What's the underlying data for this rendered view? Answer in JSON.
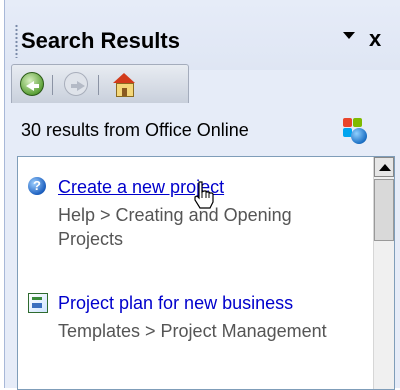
{
  "pane": {
    "title": "Search Results",
    "dropdown_icon": "dropdown-arrow-icon",
    "close_symbol": "x"
  },
  "toolbar": {
    "back_icon": "back-arrow-icon",
    "forward_icon": "forward-arrow-icon",
    "home_icon": "home-icon"
  },
  "results": {
    "count_text": "30 results from Office Online",
    "logo_icon": "office-online-icon"
  },
  "items": [
    {
      "title": "Create a new project",
      "subtitle": "Help > Creating and Opening Projects",
      "icon": "help-icon"
    },
    {
      "title": "Project plan for new business",
      "subtitle": "Templates > Project Management",
      "icon": "template-icon"
    }
  ],
  "colors": {
    "link": "#0000cc",
    "subtitle": "#555555",
    "pane_bg": "#e6ecf8"
  }
}
